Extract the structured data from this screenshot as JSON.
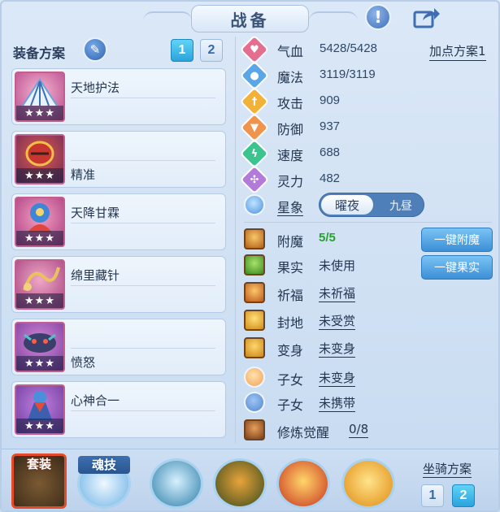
{
  "header": {
    "title": "战备"
  },
  "equipment": {
    "scheme_label": "装备方案",
    "scheme_buttons": [
      "1",
      "2"
    ],
    "items": [
      {
        "name": "天地护法",
        "stars": "★★★"
      },
      {
        "name": "精准",
        "stars": "★★★"
      },
      {
        "name": "天降甘霖",
        "stars": "★★★"
      },
      {
        "name": "绵里藏针",
        "stars": "★★★"
      },
      {
        "name": "愤怒",
        "stars": "★★★"
      },
      {
        "name": "心神合一",
        "stars": "★★★"
      }
    ]
  },
  "stats": {
    "plan_link": "加点方案1",
    "rows": [
      {
        "label": "气血",
        "value": "5428/5428",
        "color": "#e56d8f",
        "icon": "heart-icon"
      },
      {
        "label": "魔法",
        "value": "3119/3119",
        "color": "#5aa6e8",
        "icon": "magic-icon"
      },
      {
        "label": "攻击",
        "value": "909",
        "color": "#f2b23a",
        "icon": "sword-icon"
      },
      {
        "label": "防御",
        "value": "937",
        "color": "#f0934d",
        "icon": "shield-icon"
      },
      {
        "label": "速度",
        "value": "688",
        "color": "#3cc48e",
        "icon": "lightning-icon"
      },
      {
        "label": "灵力",
        "value": "482",
        "color": "#b47ad9",
        "icon": "spirit-icon"
      }
    ],
    "star_label": "星象",
    "star_toggle": {
      "on": "曜夜",
      "off": "九昼"
    }
  },
  "extras": {
    "rows": [
      {
        "label": "附魔",
        "value": "5/5"
      },
      {
        "label": "果实",
        "value": "未使用"
      },
      {
        "label": "祈福",
        "value": "未祈福"
      },
      {
        "label": "封地",
        "value": "未受赏"
      },
      {
        "label": "变身",
        "value": "未变身"
      },
      {
        "label": "子女",
        "value": "未变身"
      },
      {
        "label": "子女",
        "value": "未携带"
      },
      {
        "label": "修炼觉醒",
        "value": "0/8"
      }
    ],
    "buttons": {
      "enchant": "一键附魔",
      "fruit": "一键果实"
    }
  },
  "bottom": {
    "suit_label": "套装",
    "skill_label": "魂技",
    "mount_label": "坐骑方案",
    "mount_buttons": [
      "1",
      "2"
    ]
  }
}
